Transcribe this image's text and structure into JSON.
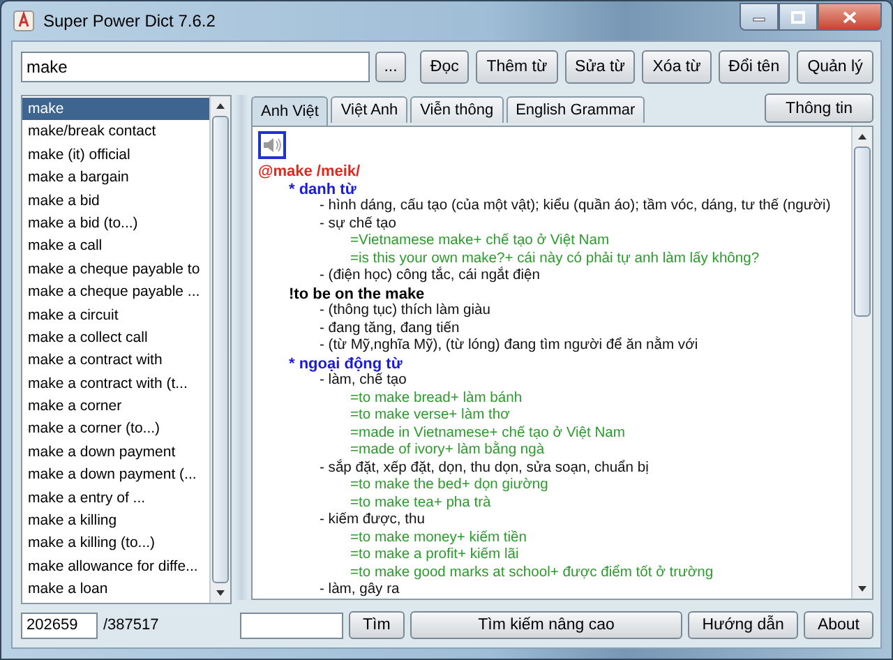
{
  "window": {
    "title": "Super Power Dict 7.6.2"
  },
  "search": {
    "value": "make",
    "browse_button": "..."
  },
  "toolbar": [
    "Đọc",
    "Thêm từ",
    "Sửa từ",
    "Xóa từ",
    "Đổi tên",
    "Quản lý"
  ],
  "word_list": [
    {
      "label": "make",
      "selected": true
    },
    {
      "label": "make/break contact",
      "selected": false
    },
    {
      "label": "make (it) official",
      "selected": false
    },
    {
      "label": "make a bargain",
      "selected": false
    },
    {
      "label": "make a bid",
      "selected": false
    },
    {
      "label": "make a bid (to...)",
      "selected": false
    },
    {
      "label": "make a call",
      "selected": false
    },
    {
      "label": "make a cheque payable to",
      "selected": false
    },
    {
      "label": "make a cheque payable ...",
      "selected": false
    },
    {
      "label": "make a circuit",
      "selected": false
    },
    {
      "label": "make a collect call",
      "selected": false
    },
    {
      "label": "make a contract with",
      "selected": false
    },
    {
      "label": "make a contract with (t...",
      "selected": false
    },
    {
      "label": "make a corner",
      "selected": false
    },
    {
      "label": "make a corner (to...)",
      "selected": false
    },
    {
      "label": "make a down payment",
      "selected": false
    },
    {
      "label": "make a down payment (...",
      "selected": false
    },
    {
      "label": "make a entry of ...",
      "selected": false
    },
    {
      "label": "make a killing",
      "selected": false
    },
    {
      "label": "make a killing (to...)",
      "selected": false
    },
    {
      "label": "make allowance for diffe...",
      "selected": false
    },
    {
      "label": "make a loan",
      "selected": false
    }
  ],
  "tabs": [
    {
      "label": "Anh Việt",
      "selected": true
    },
    {
      "label": "Việt Anh",
      "selected": false
    },
    {
      "label": "Viễn thông",
      "selected": false
    },
    {
      "label": "English Grammar",
      "selected": false
    }
  ],
  "info_button": "Thông tin",
  "entry": [
    {
      "kind": "headword",
      "text": "@make /meik/"
    },
    {
      "kind": "pos",
      "text": "* danh từ"
    },
    {
      "kind": "meaning",
      "text": "- hình dáng, cấu tạo (của một vật); kiểu (quần áo); tầm vóc, dáng, tư thế (người)"
    },
    {
      "kind": "meaning",
      "text": "- sự chế tạo"
    },
    {
      "kind": "example",
      "text": "=Vietnamese make+ chế tạo ở Việt Nam"
    },
    {
      "kind": "example",
      "text": "=is this your own make?+ cái này có phải tự anh làm lấy không?"
    },
    {
      "kind": "meaning",
      "text": "- (điện học) công tắc, cái ngắt điện"
    },
    {
      "kind": "idiom",
      "text": "!to be on the make"
    },
    {
      "kind": "meaning",
      "text": "- (thông tục) thích làm giàu"
    },
    {
      "kind": "meaning",
      "text": "- đang tăng, đang tiến"
    },
    {
      "kind": "meaning",
      "text": "- (từ Mỹ,nghĩa Mỹ), (từ lóng) đang tìm người để ăn nằm với"
    },
    {
      "kind": "pos",
      "text": "* ngoại động từ"
    },
    {
      "kind": "meaning",
      "text": "- làm, chế tạo"
    },
    {
      "kind": "example",
      "text": "=to make bread+ làm bánh"
    },
    {
      "kind": "example",
      "text": "=to make verse+ làm thơ"
    },
    {
      "kind": "example",
      "text": "=made in Vietnamese+ chế tạo ở Việt Nam"
    },
    {
      "kind": "example",
      "text": "=made of ivory+ làm bằng ngà"
    },
    {
      "kind": "meaning",
      "text": "- sắp đặt, xếp đặt, dọn, thu dọn, sửa soạn, chuẩn bị"
    },
    {
      "kind": "example",
      "text": "=to make the bed+ dọn giường"
    },
    {
      "kind": "example",
      "text": "=to make tea+ pha trà"
    },
    {
      "kind": "meaning",
      "text": "- kiếm được, thu"
    },
    {
      "kind": "example",
      "text": "=to make money+ kiếm tiền"
    },
    {
      "kind": "example",
      "text": "=to make a profit+ kiếm lãi"
    },
    {
      "kind": "example",
      "text": "=to make good marks at school+ được điểm tốt ở trường"
    },
    {
      "kind": "meaning",
      "text": "- làm, gây ra"
    }
  ],
  "footer": {
    "index": "202659",
    "total": "/387517",
    "find_button": "Tìm",
    "advanced_button": "Tìm kiếm nâng cao",
    "help_button": "Hướng dẫn",
    "about_button": "About"
  }
}
